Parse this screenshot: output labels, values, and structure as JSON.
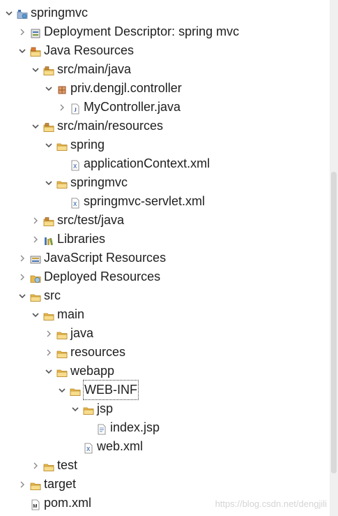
{
  "tree": {
    "nodes": [
      {
        "label": "springmvc",
        "level": 0,
        "twisty": "open",
        "icon": "web-project-icon"
      },
      {
        "label": "Deployment Descriptor: spring mvc",
        "level": 1,
        "twisty": "closed",
        "icon": "deployment-descriptor-icon"
      },
      {
        "label": "Java Resources",
        "level": 1,
        "twisty": "open",
        "icon": "java-resources-icon"
      },
      {
        "label": "src/main/java",
        "level": 2,
        "twisty": "open",
        "icon": "source-folder-icon"
      },
      {
        "label": "priv.dengjl.controller",
        "level": 3,
        "twisty": "open",
        "icon": "package-icon"
      },
      {
        "label": "MyController.java",
        "level": 4,
        "twisty": "closed",
        "icon": "java-file-icon"
      },
      {
        "label": "src/main/resources",
        "level": 2,
        "twisty": "open",
        "icon": "source-folder-icon"
      },
      {
        "label": "spring",
        "level": 3,
        "twisty": "open",
        "icon": "folder-icon"
      },
      {
        "label": "applicationContext.xml",
        "level": 4,
        "twisty": "none",
        "icon": "xml-file-icon"
      },
      {
        "label": "springmvc",
        "level": 3,
        "twisty": "open",
        "icon": "folder-icon"
      },
      {
        "label": "springmvc-servlet.xml",
        "level": 4,
        "twisty": "none",
        "icon": "xml-file-icon"
      },
      {
        "label": "src/test/java",
        "level": 2,
        "twisty": "closed",
        "icon": "source-folder-icon"
      },
      {
        "label": "Libraries",
        "level": 2,
        "twisty": "closed",
        "icon": "libraries-icon"
      },
      {
        "label": "JavaScript Resources",
        "level": 1,
        "twisty": "closed",
        "icon": "javascript-resources-icon"
      },
      {
        "label": "Deployed Resources",
        "level": 1,
        "twisty": "closed",
        "icon": "deployed-resources-icon"
      },
      {
        "label": "src",
        "level": 1,
        "twisty": "open",
        "icon": "folder-icon"
      },
      {
        "label": "main",
        "level": 2,
        "twisty": "open",
        "icon": "folder-icon"
      },
      {
        "label": "java",
        "level": 3,
        "twisty": "closed",
        "icon": "folder-icon"
      },
      {
        "label": "resources",
        "level": 3,
        "twisty": "closed",
        "icon": "folder-icon"
      },
      {
        "label": "webapp",
        "level": 3,
        "twisty": "open",
        "icon": "folder-icon"
      },
      {
        "label": "WEB-INF",
        "level": 4,
        "twisty": "open",
        "icon": "folder-icon",
        "selected": true
      },
      {
        "label": "jsp",
        "level": 5,
        "twisty": "open",
        "icon": "folder-icon"
      },
      {
        "label": "index.jsp",
        "level": 6,
        "twisty": "none",
        "icon": "jsp-file-icon"
      },
      {
        "label": "web.xml",
        "level": 5,
        "twisty": "none",
        "icon": "xml-file-icon"
      },
      {
        "label": "test",
        "level": 2,
        "twisty": "closed",
        "icon": "folder-icon"
      },
      {
        "label": "target",
        "level": 1,
        "twisty": "closed",
        "icon": "folder-icon"
      },
      {
        "label": "pom.xml",
        "level": 1,
        "twisty": "none",
        "icon": "maven-pom-icon"
      }
    ]
  },
  "watermark": "https://blog.csdn.net/dengjili",
  "colors": {
    "folder": "#e8b84a",
    "folder_light": "#f7dc8c",
    "package": "#a0522d",
    "java_file": "#3b5998",
    "xml_file": "#5b7fb5",
    "twisty": "#555555",
    "scrollbar_thumb": "#d9d9d9"
  }
}
